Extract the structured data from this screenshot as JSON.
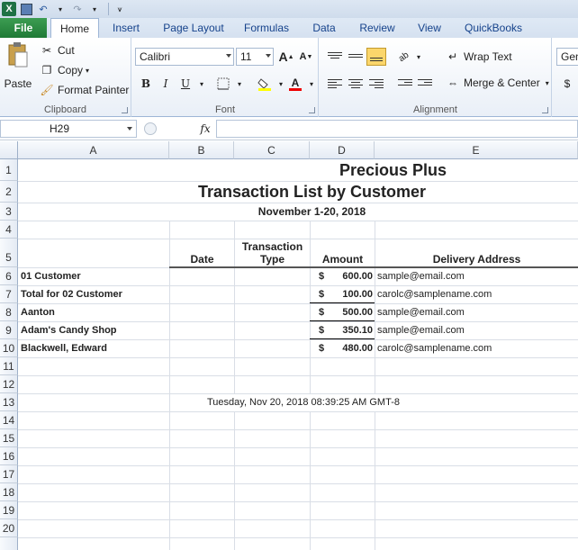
{
  "qat": {
    "undo_icon": "undo-icon",
    "redo_icon": "redo-icon",
    "save_icon": "save-icon"
  },
  "tabs": [
    {
      "label": "File"
    },
    {
      "label": "Home"
    },
    {
      "label": "Insert"
    },
    {
      "label": "Page Layout"
    },
    {
      "label": "Formulas"
    },
    {
      "label": "Data"
    },
    {
      "label": "Review"
    },
    {
      "label": "View"
    },
    {
      "label": "QuickBooks"
    }
  ],
  "clipboard": {
    "paste": "Paste",
    "cut": "Cut",
    "copy": "Copy",
    "format_painter": "Format Painter",
    "group": "Clipboard"
  },
  "font": {
    "name": "Calibri",
    "size": "11",
    "group": "Font",
    "bold": "B",
    "italic": "I",
    "underline": "U",
    "grow": "A",
    "shrink": "A"
  },
  "alignment": {
    "wrap_text": "Wrap Text",
    "merge_center": "Merge & Center",
    "group": "Alignment"
  },
  "number": {
    "format": "Gen",
    "currency": "$"
  },
  "formula_bar": {
    "name_box": "H29",
    "fx": "fx",
    "value": ""
  },
  "columns": [
    "A",
    "B",
    "C",
    "D",
    "E"
  ],
  "rows": [
    "1",
    "2",
    "3",
    "4",
    "5",
    "6",
    "7",
    "8",
    "9",
    "10",
    "11",
    "12",
    "13",
    "14",
    "15",
    "16",
    "17",
    "18",
    "19",
    "20"
  ],
  "report": {
    "company": "Precious Plus",
    "title": "Transaction List by  Customer",
    "period": "November 1-20, 2018",
    "headers": {
      "date": "Date",
      "type_1": "Transaction",
      "type_2": "Type",
      "amount": "Amount",
      "address": "Delivery Address"
    },
    "rows": [
      {
        "name": "01 Customer",
        "currency": "$",
        "amount": "600.00",
        "address": "sample@email.com"
      },
      {
        "name": "Total for 02 Customer",
        "currency": "$",
        "amount": "100.00",
        "address": "carolc@samplename.com"
      },
      {
        "name": "Aanton",
        "currency": "$",
        "amount": "500.00",
        "address": "sample@email.com"
      },
      {
        "name": "Adam's Candy Shop",
        "currency": "$",
        "amount": "350.10",
        "address": "sample@email.com"
      },
      {
        "name": "Blackwell, Edward",
        "currency": "$",
        "amount": "480.00",
        "address": "carolc@samplename.com"
      }
    ],
    "timestamp": "Tuesday, Nov 20, 2018 08:39:25 AM GMT-8"
  }
}
